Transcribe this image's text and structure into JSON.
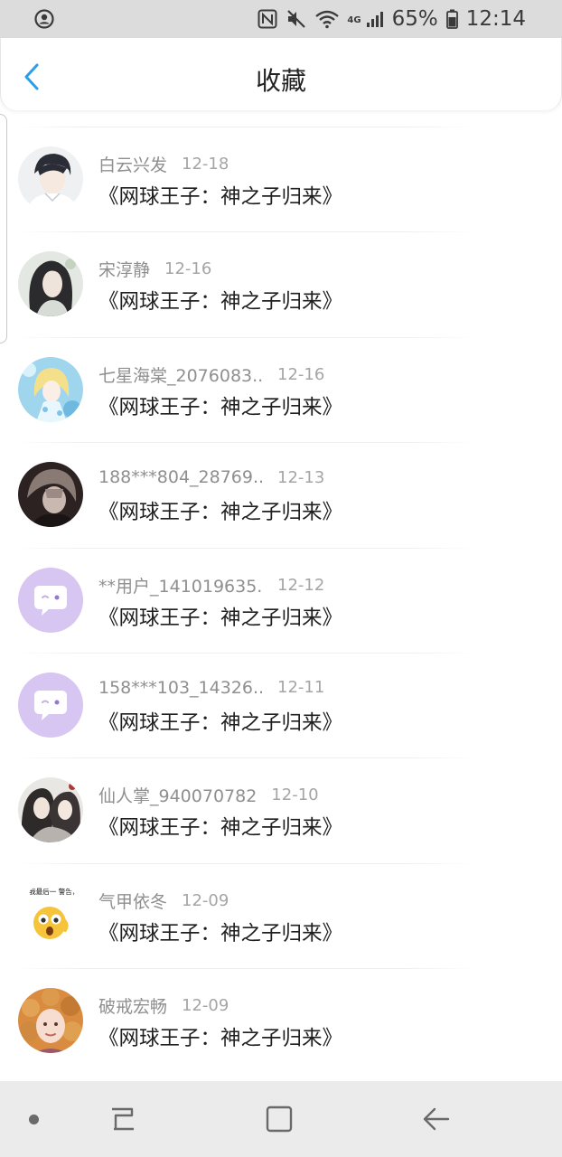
{
  "status_bar": {
    "battery_percent": "65%",
    "time": "12:14",
    "network": "4G",
    "icons": [
      "account-circle-icon",
      "nfc-icon",
      "mute-icon",
      "wifi-icon",
      "signal-icon",
      "battery-icon"
    ]
  },
  "header": {
    "title": "收藏",
    "back_icon": "chevron-left-icon",
    "accent_color": "#2a9ee8"
  },
  "favorites": [
    {
      "name": "白云兴发",
      "date": "12-18",
      "book": "《网球王子：神之子归来》",
      "avatar": "anime-boy-white-shirt"
    },
    {
      "name": "宋淳静",
      "date": "12-16",
      "book": "《网球王子：神之子归来》",
      "avatar": "anime-long-hair"
    },
    {
      "name": "七星海棠_2076083...",
      "date": "12-16",
      "book": "《网球王子：神之子归来》",
      "avatar": "anime-girl-blue"
    },
    {
      "name": "188***804_28769...",
      "date": "12-13",
      "book": "《网球王子：神之子归来》",
      "avatar": "dark-portrait"
    },
    {
      "name": "**用户_141019635...",
      "date": "12-12",
      "book": "《网球王子：神之子归来》",
      "avatar": "default-chat-bubble"
    },
    {
      "name": "158***103_14326...",
      "date": "12-11",
      "book": "《网球王子：神之子归来》",
      "avatar": "default-chat-bubble"
    },
    {
      "name": "仙人掌_940070782",
      "date": "12-10",
      "book": "《网球王子：神之子归来》",
      "avatar": "anime-couple"
    },
    {
      "name": "气甲依冬",
      "date": "12-09",
      "book": "《网球王子：神之子归来》",
      "avatar": "emoji-meme"
    },
    {
      "name": "破戒宏畅",
      "date": "12-09",
      "book": "《网球王子：神之子归来》",
      "avatar": "curly-hair-child"
    }
  ],
  "avatar_meme_text": "食，我最后一 警告你！",
  "nav_bar": {
    "icons": [
      "dot-icon",
      "recent-apps-icon",
      "home-icon",
      "back-arrow-icon"
    ]
  }
}
